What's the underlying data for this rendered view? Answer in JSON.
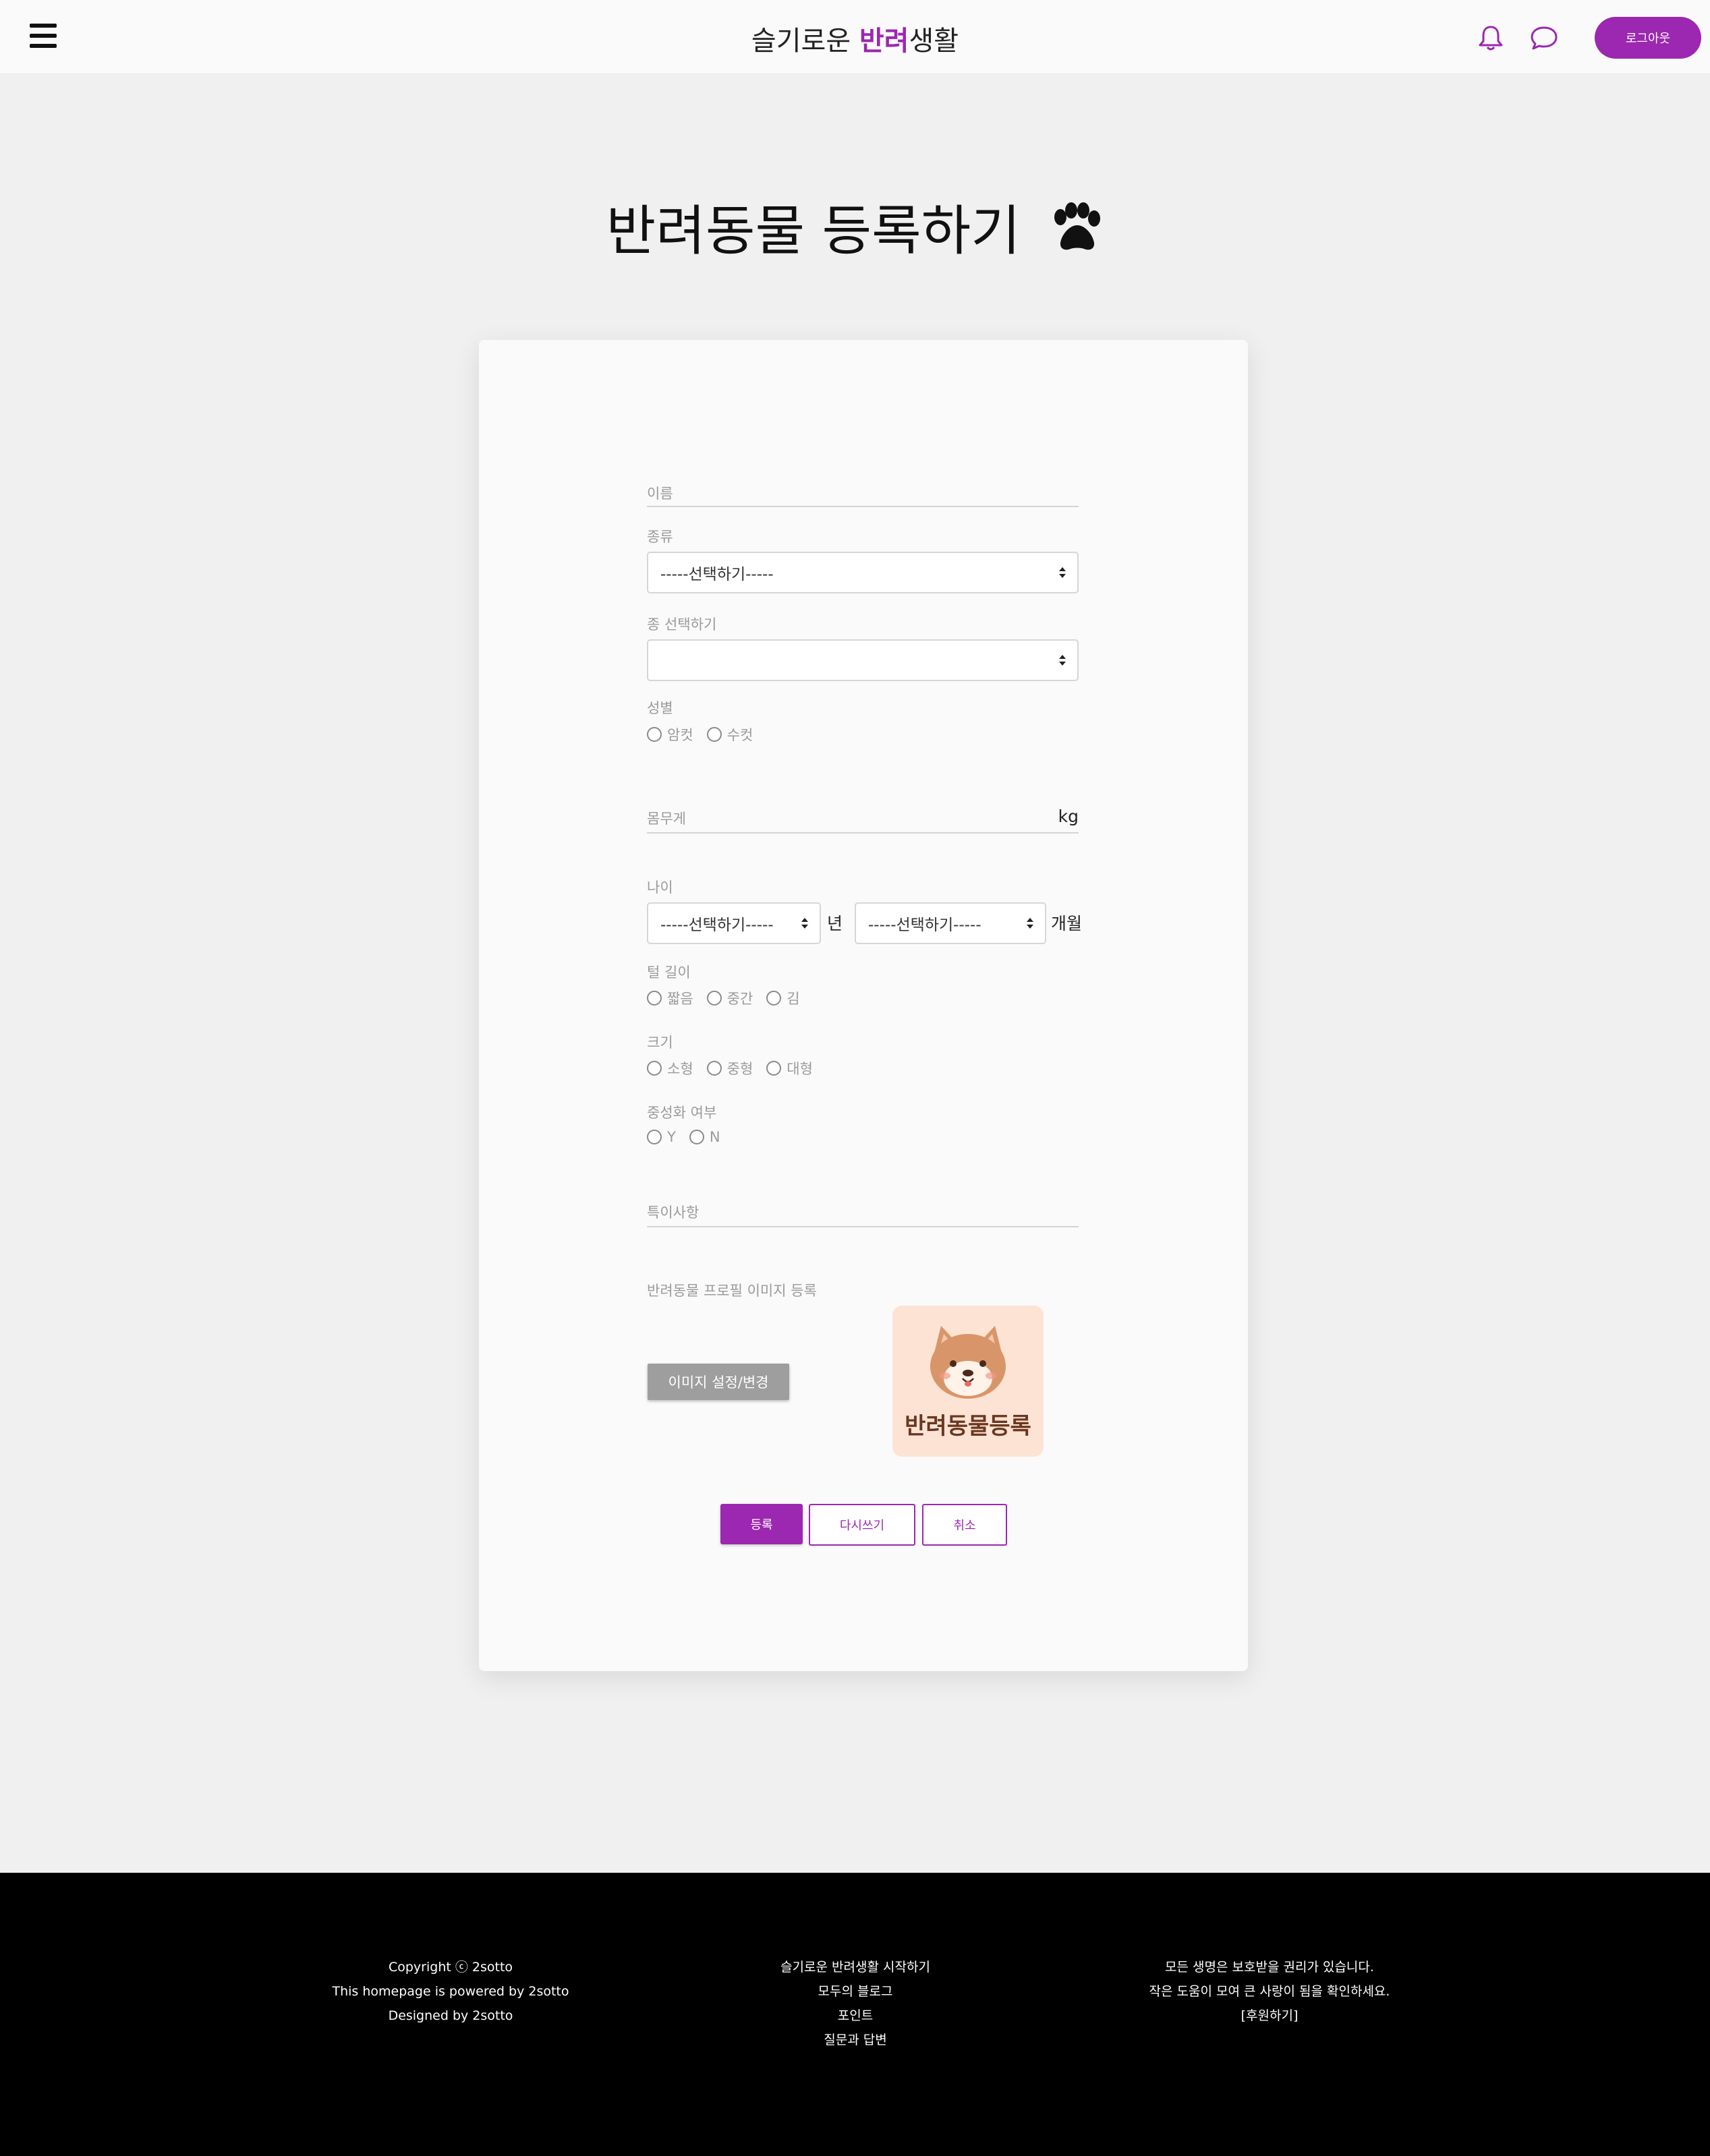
{
  "header": {
    "brand_prefix": "슬기로운 ",
    "brand_accent": "반려",
    "brand_suffix": "생활",
    "logout_label": "로그아웃",
    "icons": [
      "hamburger-menu-icon",
      "bell-icon",
      "chat-bubble-icon"
    ],
    "accent_color": "#9c27b0"
  },
  "page": {
    "title": "반려동물 등록하기",
    "title_icon": "paw-icon"
  },
  "form": {
    "name_placeholder": "이름",
    "kind_label": "종류",
    "kind_selected": "-----선택하기-----",
    "breed_label": "종 선택하기",
    "breed_selected": "",
    "gender_label": "성별",
    "gender_options": [
      "암컷",
      "수컷"
    ],
    "weight_placeholder": "몸무게",
    "weight_unit": "kg",
    "age_label": "나이",
    "age_year_selected": "-----선택하기-----",
    "age_year_unit": "년",
    "age_month_selected": "-----선택하기-----",
    "age_month_unit": "개월",
    "fur_label": "털 길이",
    "fur_options": [
      "짧음",
      "중간",
      "김"
    ],
    "size_label": "크기",
    "size_options": [
      "소형",
      "중형",
      "대형"
    ],
    "neuter_label": "중성화 여부",
    "neuter_options": [
      "Y",
      "N"
    ],
    "notes_placeholder": "특이사항",
    "image_label": "반려동물 프로필 이미지 등록",
    "image_button": "이미지 설정/변경",
    "preview_text": "반려동물등록",
    "submit_label": "등록",
    "reset_label": "다시쓰기",
    "cancel_label": "취소"
  },
  "footer": {
    "col1": [
      "Copyright ⓒ 2sotto",
      "This homepage is powered by 2sotto",
      "Designed by 2sotto"
    ],
    "col2": [
      "슬기로운 반려생활 시작하기",
      "모두의 블로그",
      "포인트",
      "질문과 답변"
    ],
    "col3": [
      "모든 생명은 보호받을 권리가 있습니다.",
      "작은 도움이 모여 큰 사랑이 됨을 확인하세요.",
      "[후원하기]"
    ]
  }
}
